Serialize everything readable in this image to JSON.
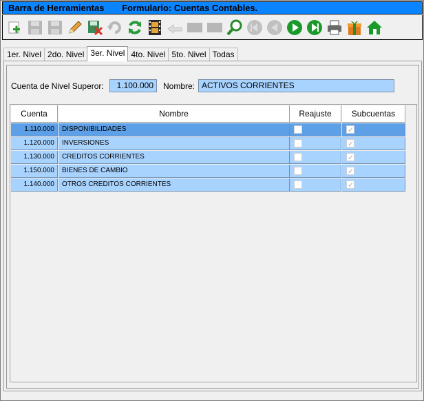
{
  "titlebar": {
    "left": "Barra de Herramientas",
    "right": "Formulario: Cuentas Contables."
  },
  "toolbar": {
    "buttons": [
      {
        "name": "add-icon",
        "enabled": true
      },
      {
        "name": "save-icon",
        "enabled": false
      },
      {
        "name": "save-as-icon",
        "enabled": false
      },
      {
        "name": "edit-pencil-icon",
        "enabled": true
      },
      {
        "name": "delete-icon",
        "enabled": true
      },
      {
        "name": "undo-icon",
        "enabled": false
      },
      {
        "name": "refresh-icon",
        "enabled": true
      },
      {
        "name": "film-icon",
        "enabled": true
      },
      {
        "name": "back-arrow-icon",
        "enabled": false
      },
      {
        "name": "blank-icon",
        "enabled": false
      },
      {
        "name": "blank-icon-2",
        "enabled": false
      },
      {
        "name": "search-icon",
        "enabled": true
      },
      {
        "name": "first-record-icon",
        "enabled": false
      },
      {
        "name": "previous-record-icon",
        "enabled": false
      },
      {
        "name": "next-record-icon",
        "enabled": true
      },
      {
        "name": "last-record-icon",
        "enabled": true
      },
      {
        "name": "print-icon",
        "enabled": true
      },
      {
        "name": "gift-icon",
        "enabled": true
      },
      {
        "name": "home-icon",
        "enabled": true
      }
    ]
  },
  "tabs": [
    "1er. Nivel",
    "2do. Nivel",
    "3er. Nivel",
    "4to. Nivel",
    "5to. Nivel",
    "Todas"
  ],
  "active_tab": 2,
  "form": {
    "parent_label": "Cuenta de Nivel Superor:",
    "parent_value": "1.100.000",
    "name_label": "Nombre:",
    "name_value": "ACTIVOS CORRIENTES"
  },
  "grid": {
    "headers": [
      "Cuenta",
      "Nombre",
      "Reajuste",
      "Subcuentas"
    ],
    "rows": [
      {
        "cuenta": "1.110.000",
        "nombre": "DISPONIBILIDADES",
        "reajuste": false,
        "subcuentas": true,
        "selected": true
      },
      {
        "cuenta": "1.120.000",
        "nombre": "INVERSIONES",
        "reajuste": false,
        "subcuentas": true,
        "selected": false
      },
      {
        "cuenta": "1.130.000",
        "nombre": "CREDITOS CORRIENTES",
        "reajuste": false,
        "subcuentas": true,
        "selected": false
      },
      {
        "cuenta": "1.150.000",
        "nombre": "BIENES DE CAMBIO",
        "reajuste": false,
        "subcuentas": true,
        "selected": false
      },
      {
        "cuenta": "1.140.000",
        "nombre": "OTROS CREDITOS CORRIENTES",
        "reajuste": false,
        "subcuentas": true,
        "selected": false
      }
    ]
  },
  "colors": {
    "title_bg": "#0a84ff",
    "field_bg": "#a9d3ff",
    "selected_row": "#5ea0e8"
  }
}
